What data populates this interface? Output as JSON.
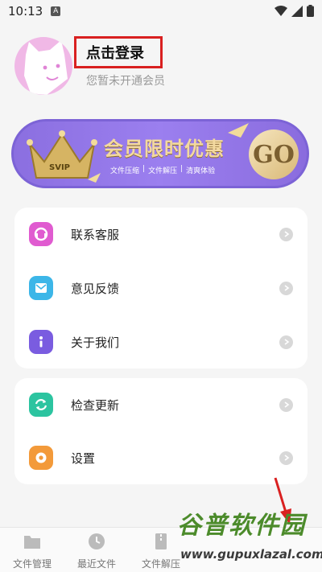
{
  "status_bar": {
    "time": "10:13",
    "notification": "A"
  },
  "profile": {
    "login_label": "点击登录",
    "membership_status": "您暂未开通会员"
  },
  "vip_banner": {
    "title": "会员限时优惠",
    "crown_label": "SVIP",
    "features": [
      "文件压缩",
      "文件解压",
      "清爽体验"
    ],
    "go_label": "GO"
  },
  "menu_group_1": [
    {
      "label": "联系客服",
      "icon": "headset-icon",
      "color": "#e05bd0"
    },
    {
      "label": "意见反馈",
      "icon": "feedback-icon",
      "color": "#3cb6e8"
    },
    {
      "label": "关于我们",
      "icon": "info-icon",
      "color": "#7a5ce0"
    }
  ],
  "menu_group_2": [
    {
      "label": "检查更新",
      "icon": "refresh-icon",
      "color": "#2cc4a0"
    },
    {
      "label": "设置",
      "icon": "settings-icon",
      "color": "#f39a3a"
    }
  ],
  "bottom_nav": [
    {
      "label": "文件管理",
      "icon": "folder-icon"
    },
    {
      "label": "最近文件",
      "icon": "clock-icon"
    },
    {
      "label": "文件解压",
      "icon": "zip-icon"
    }
  ],
  "watermark": {
    "text": "谷普软件园",
    "url": "www.gupuxlazal.com"
  }
}
